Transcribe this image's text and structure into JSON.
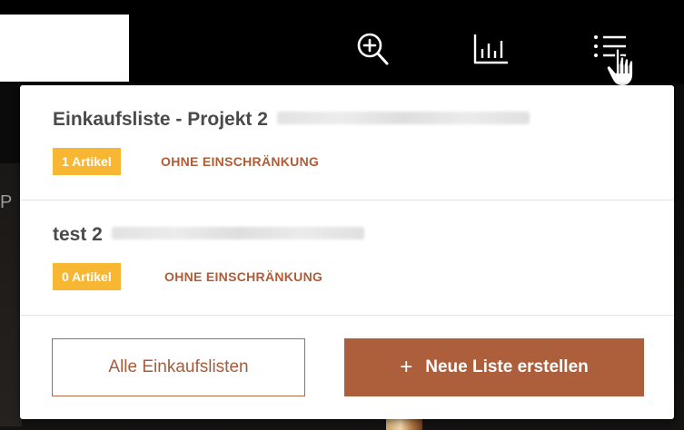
{
  "header": {
    "zoom_icon": "zoom-in-icon",
    "stats_icon": "bar-chart-icon",
    "list_icon": "list-icon",
    "cursor": "hand-pointer-icon"
  },
  "background": {
    "peek_letter": "P"
  },
  "shopping_lists": {
    "entries": [
      {
        "title": "Einkaufsliste - Projekt 2",
        "badge": "1 Artikel",
        "restriction": "OHNE EINSCHRÄNKUNG"
      },
      {
        "title": "test 2",
        "badge": "0 Artikel",
        "restriction": "OHNE EINSCHRÄNKUNG"
      }
    ],
    "all_lists_label": "Alle Einkaufslisten",
    "new_list_plus": "+",
    "new_list_label": "Neue Liste erstellen"
  },
  "colors": {
    "badge": "#f7b733",
    "accent": "#ad5f3c",
    "restriction_text": "#b05c36"
  }
}
